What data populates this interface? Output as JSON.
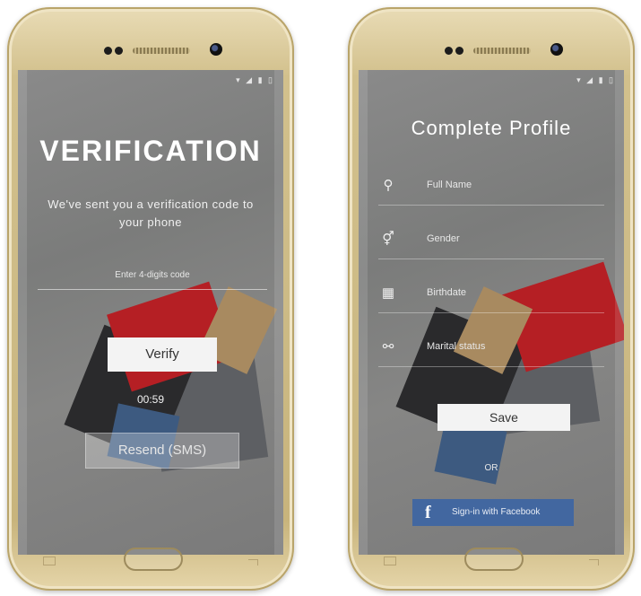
{
  "verification": {
    "title": "VERIFICATION",
    "subtitle": "We've sent you a verification code to your phone",
    "code_placeholder": "Enter 4-digits code",
    "verify_label": "Verify",
    "timer": "00:59",
    "resend_label": "Resend (SMS)"
  },
  "profile": {
    "title": "Complete Profile",
    "fields": [
      {
        "icon": "person-icon",
        "label": "Full Name"
      },
      {
        "icon": "gender-icon",
        "label": "Gender"
      },
      {
        "icon": "calendar-icon",
        "label": "Birthdate"
      },
      {
        "icon": "rings-icon",
        "label": "Marital status"
      }
    ],
    "save_label": "Save",
    "or_label": "OR",
    "facebook_label": "Sign-in with Facebook",
    "facebook_logo": "f"
  },
  "colors": {
    "facebook": "#4267a0",
    "bezel": "#d2c08c",
    "bag_red": "#b51f24"
  }
}
